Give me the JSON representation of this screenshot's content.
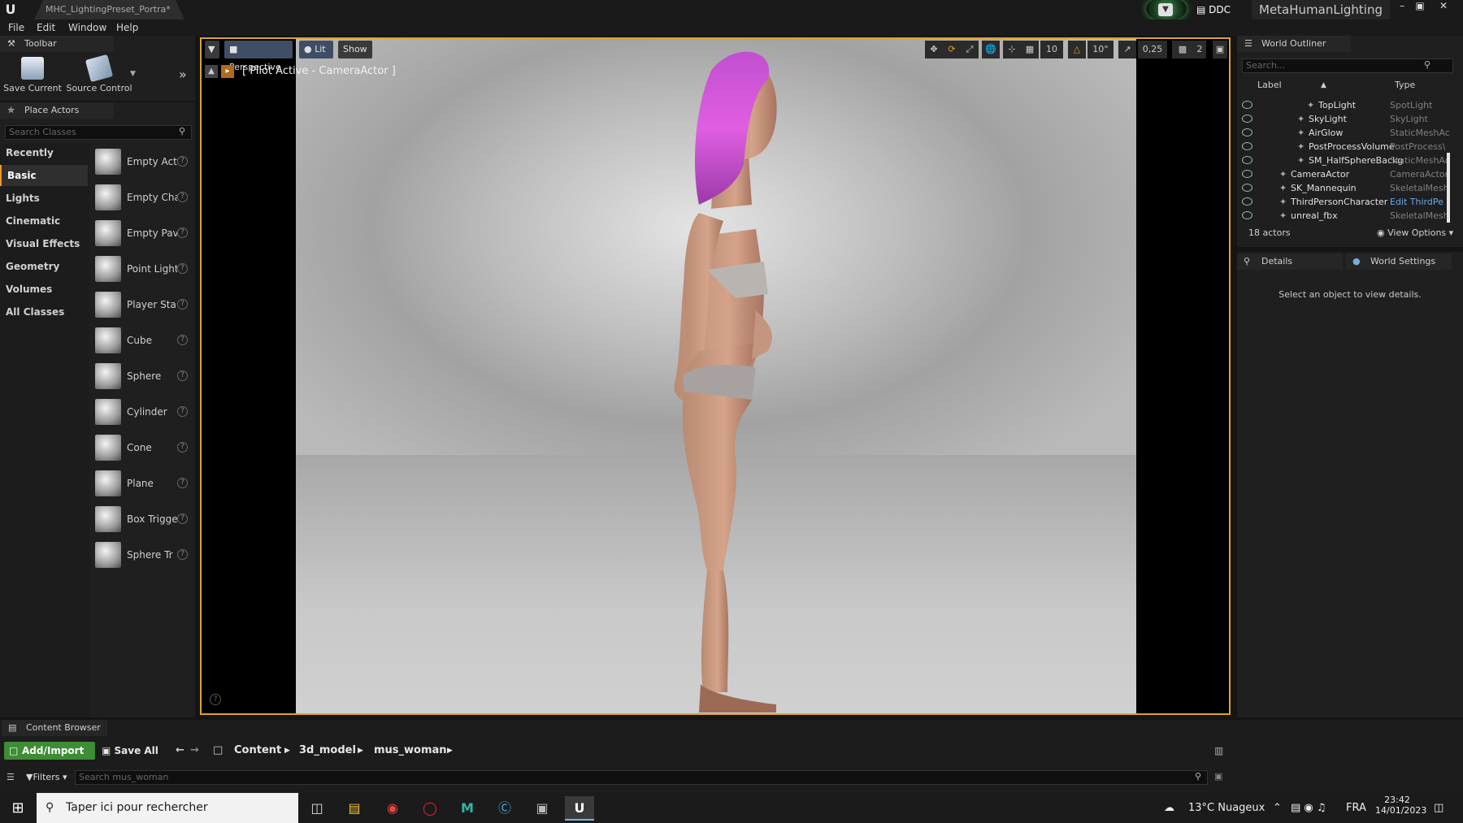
{
  "titlebar": {
    "doc_tab": "MHC_LightingPreset_Portra*",
    "ddc": "DDC",
    "project": "MetaHumanLighting",
    "win_min": "–",
    "win_max": "▣",
    "win_close": "✕"
  },
  "menu": [
    "File",
    "Edit",
    "Window",
    "Help"
  ],
  "toolbar": {
    "title": "Toolbar",
    "save_current": "Save Current",
    "source_control": "Source Control"
  },
  "place_actors": {
    "title": "Place Actors",
    "search_placeholder": "Search Classes",
    "categories": [
      "Recently Placed",
      "Basic",
      "Lights",
      "Cinematic",
      "Visual Effects",
      "Geometry",
      "Volumes",
      "All Classes"
    ],
    "active_category": "Basic",
    "items": [
      "Empty Act",
      "Empty Cha",
      "Empty Pav",
      "Point Light",
      "Player Sta",
      "Cube",
      "Sphere",
      "Cylinder",
      "Cone",
      "Plane",
      "Box Trigge",
      "Sphere Tr"
    ]
  },
  "viewport": {
    "perspective": "Perspective",
    "lit": "Lit",
    "show": "Show",
    "pilot": "[ Pilot Active - CameraActor ]",
    "grid": "10",
    "rot": "10°",
    "scale": "0,25",
    "cam": "2"
  },
  "outliner": {
    "title": "World Outliner",
    "search_placeholder": "Search...",
    "col_label": "Label",
    "col_type": "Type",
    "rows": [
      {
        "label": "TopLight",
        "type": "SpotLight"
      },
      {
        "label": "SkyLight",
        "type": "SkyLight"
      },
      {
        "label": "AirGlow",
        "type": "StaticMeshAc"
      },
      {
        "label": "PostProcessVolume",
        "type": "PostProcess\\"
      },
      {
        "label": "SM_HalfSphereBackg",
        "type": "StaticMeshAc"
      },
      {
        "label": "CameraActor",
        "type": "CameraActor"
      },
      {
        "label": "SK_Mannequin",
        "type": "SkeletalMesh"
      },
      {
        "label": "ThirdPersonCharacter",
        "type": "Edit ThirdPe"
      },
      {
        "label": "unreal_fbx",
        "type": "SkeletalMesh"
      }
    ],
    "count": "18 actors",
    "view_options": "View Options"
  },
  "details": {
    "tab_details": "Details",
    "tab_world": "World Settings",
    "empty_msg": "Select an object to view details."
  },
  "content_browser": {
    "title": "Content Browser",
    "add_import": "Add/Import",
    "save_all": "Save All",
    "path": [
      "Content",
      "3d_model",
      "mus_woman"
    ],
    "filters": "Filters",
    "search_placeholder": "Search mus_woman"
  },
  "taskbar": {
    "search": "Taper ici pour rechercher",
    "weather": "13°C Nuageux",
    "lang": "FRA",
    "time": "23:42",
    "date": "14/01/2023"
  }
}
